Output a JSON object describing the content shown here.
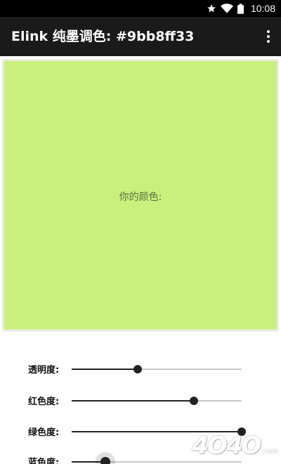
{
  "status_bar": {
    "time": "10:08"
  },
  "app_bar": {
    "title": "Elink 纯墨调色: #9bb8ff33"
  },
  "swatch": {
    "label": "你的颜色:",
    "color": "#c9ef7c"
  },
  "sliders": [
    {
      "label": "透明度:",
      "value": 0.39
    },
    {
      "label": "红色度:",
      "value": 0.72
    },
    {
      "label": "绿色度:",
      "value": 1.0
    },
    {
      "label": "蓝色度:",
      "value": 0.2
    }
  ],
  "watermark": {
    "text": "4O4O",
    "suffix": ".com"
  }
}
